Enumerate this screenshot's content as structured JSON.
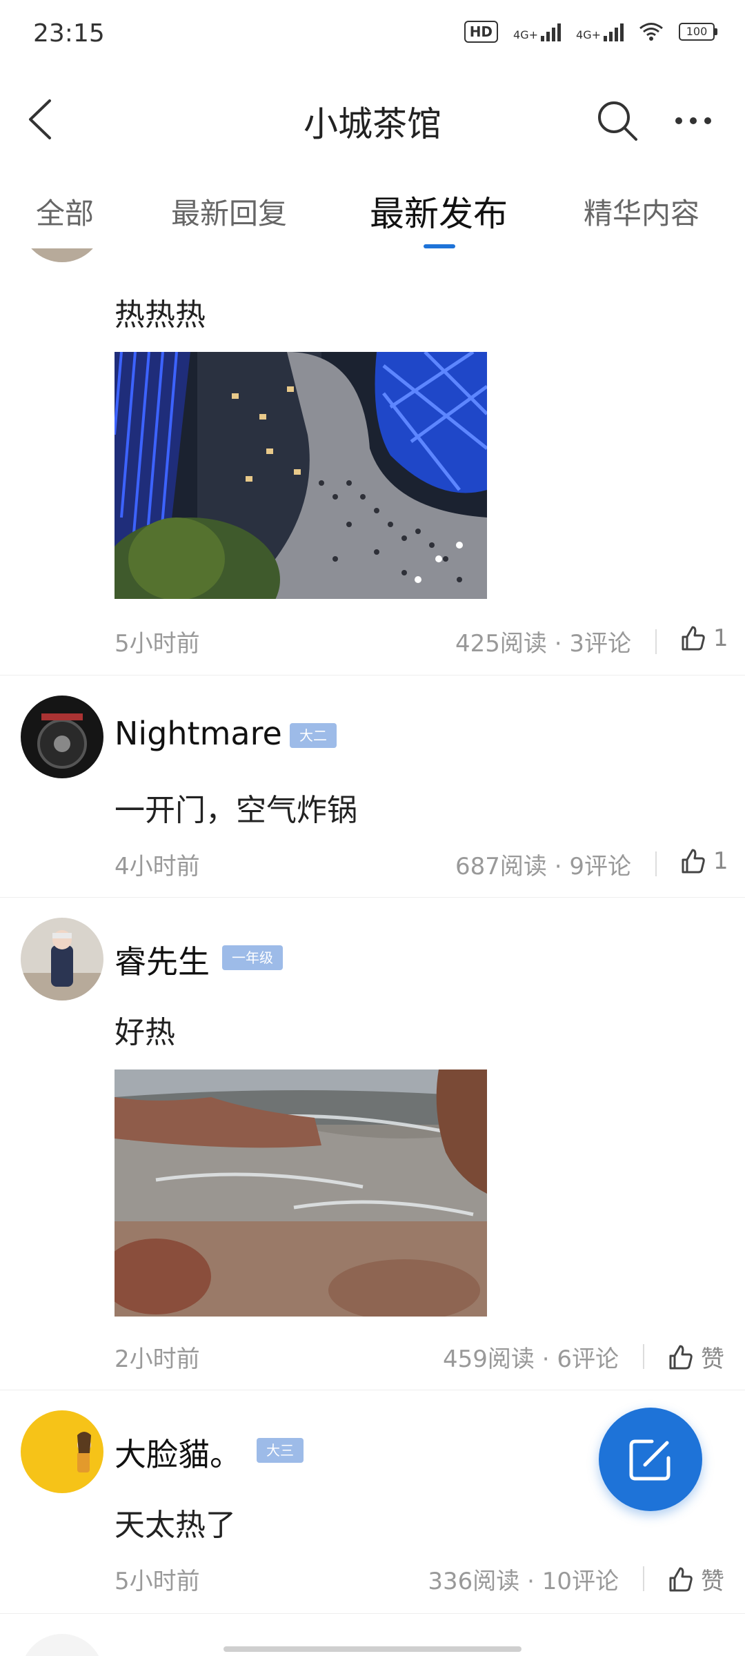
{
  "status_bar": {
    "time": "23:15",
    "network": "4G+",
    "hd": "HD",
    "battery": "100"
  },
  "header": {
    "title": "小城茶馆"
  },
  "tabs": [
    {
      "label": "全部"
    },
    {
      "label": "最新回复"
    },
    {
      "label": "最新发布",
      "active": true
    },
    {
      "label": "精华内容"
    }
  ],
  "posts": [
    {
      "content": "热热热",
      "time": "5小时前",
      "reads": "425阅读",
      "comments": "3评论",
      "likes": "1"
    },
    {
      "name": "Nightmare",
      "badge": "大二",
      "content": "一开门，空气炸锅",
      "time": "4小时前",
      "reads": "687阅读",
      "comments": "9评论",
      "likes": "1"
    },
    {
      "name": "睿先生",
      "badge": "一年级",
      "content": "好热",
      "time": "2小时前",
      "reads": "459阅读",
      "comments": "6评论",
      "likes": "赞"
    },
    {
      "name": "大脸貓。",
      "badge": "大三",
      "content": "天太热了",
      "time": "5小时前",
      "reads": "336阅读",
      "comments": "10评论",
      "likes": "赞"
    }
  ],
  "colors": {
    "accent": "#1e73d8",
    "badge": "#9dbbe8"
  }
}
